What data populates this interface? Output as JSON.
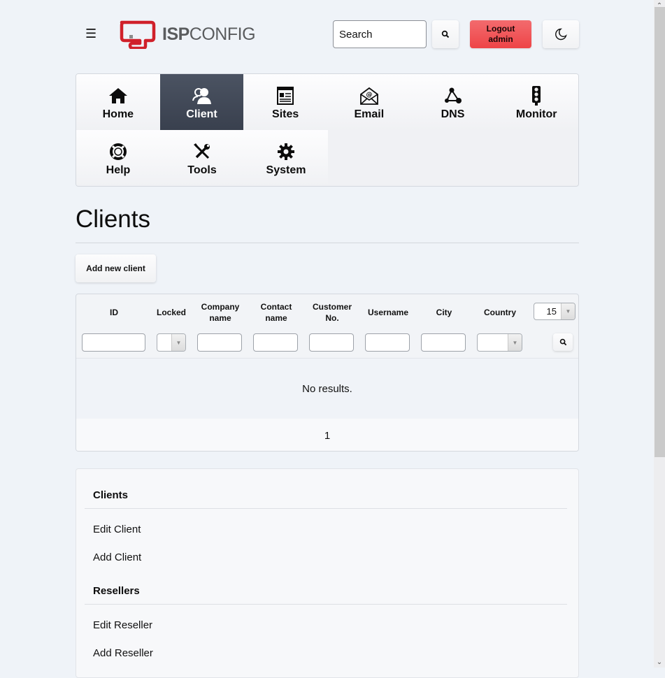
{
  "header": {
    "menu_icon": "hamburger-icon",
    "logo": {
      "bold": "ISP",
      "regular": "CONFIG",
      "brand_color": "#d0202a"
    },
    "search_placeholder": "Search",
    "search_button_icon": "search-icon",
    "logout_line1": "Logout",
    "logout_line2": "admin",
    "logout_color": "#ee4447",
    "theme_toggle_icon": "moon-icon"
  },
  "nav": {
    "items": [
      {
        "label": "Home",
        "icon": "home-icon",
        "active": false
      },
      {
        "label": "Client",
        "icon": "client-icon",
        "active": true
      },
      {
        "label": "Sites",
        "icon": "sites-icon",
        "active": false
      },
      {
        "label": "Email",
        "icon": "email-icon",
        "active": false
      },
      {
        "label": "DNS",
        "icon": "dns-icon",
        "active": false
      },
      {
        "label": "Monitor",
        "icon": "monitor-icon",
        "active": false
      },
      {
        "label": "Help",
        "icon": "help-icon",
        "active": false
      },
      {
        "label": "Tools",
        "icon": "tools-icon",
        "active": false
      },
      {
        "label": "System",
        "icon": "system-icon",
        "active": false
      }
    ],
    "active_color": "#3f4655"
  },
  "main": {
    "title": "Clients",
    "add_button": "Add new client",
    "table": {
      "columns": [
        {
          "line1": "ID",
          "line2": ""
        },
        {
          "line1": "Locked",
          "line2": ""
        },
        {
          "line1": "Company",
          "line2": "name"
        },
        {
          "line1": "Contact",
          "line2": "name"
        },
        {
          "line1": "Customer",
          "line2": "No."
        },
        {
          "line1": "Username",
          "line2": ""
        },
        {
          "line1": "City",
          "line2": ""
        },
        {
          "line1": "Country",
          "line2": ""
        }
      ],
      "filters": {
        "id": "",
        "locked": "",
        "company_name": "",
        "contact_name": "",
        "customer_no": "",
        "username": "",
        "city": "",
        "country": ""
      },
      "per_page": "15",
      "empty_message": "No results.",
      "pages": [
        "1"
      ]
    }
  },
  "side_menu": {
    "sections": [
      {
        "title": "Clients",
        "links": [
          "Edit Client",
          "Add Client"
        ]
      },
      {
        "title": "Resellers",
        "links": [
          "Edit Reseller",
          "Add Reseller"
        ]
      }
    ]
  }
}
